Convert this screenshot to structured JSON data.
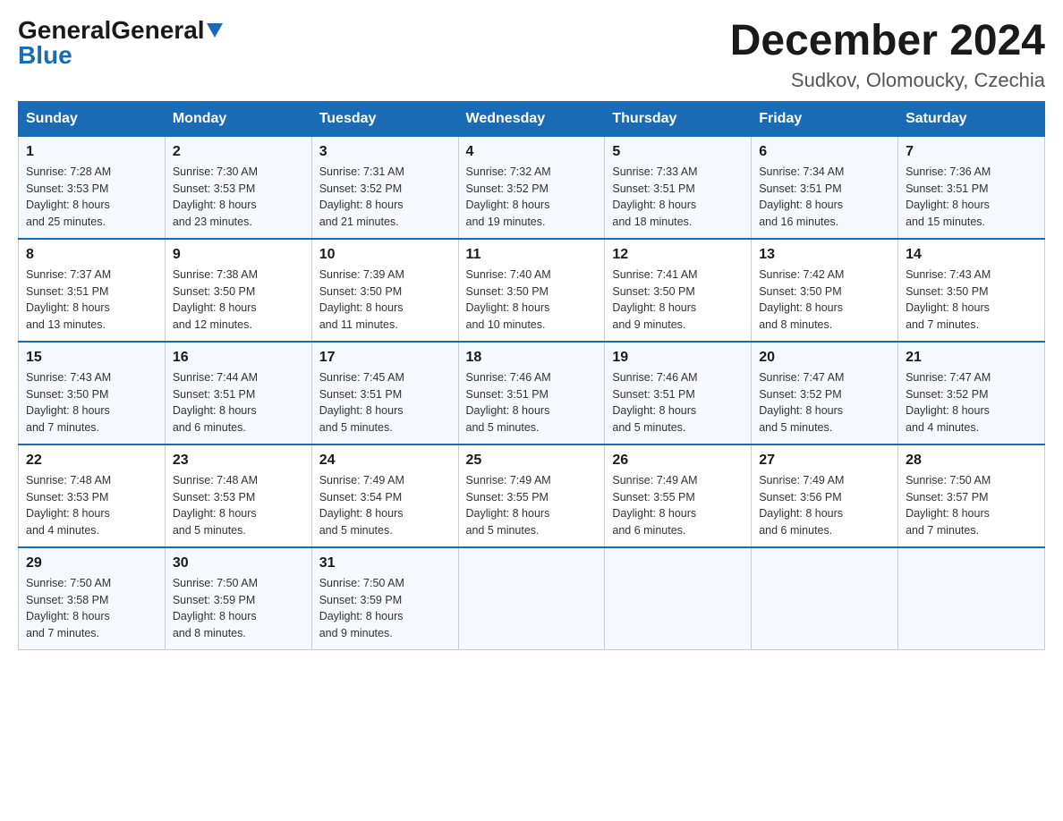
{
  "header": {
    "logo_general": "General",
    "logo_blue": "Blue",
    "month_year": "December 2024",
    "location": "Sudkov, Olomoucky, Czechia"
  },
  "days_of_week": [
    "Sunday",
    "Monday",
    "Tuesday",
    "Wednesday",
    "Thursday",
    "Friday",
    "Saturday"
  ],
  "weeks": [
    [
      {
        "day": "1",
        "sunrise": "7:28 AM",
        "sunset": "3:53 PM",
        "daylight": "8 hours and 25 minutes."
      },
      {
        "day": "2",
        "sunrise": "7:30 AM",
        "sunset": "3:53 PM",
        "daylight": "8 hours and 23 minutes."
      },
      {
        "day": "3",
        "sunrise": "7:31 AM",
        "sunset": "3:52 PM",
        "daylight": "8 hours and 21 minutes."
      },
      {
        "day": "4",
        "sunrise": "7:32 AM",
        "sunset": "3:52 PM",
        "daylight": "8 hours and 19 minutes."
      },
      {
        "day": "5",
        "sunrise": "7:33 AM",
        "sunset": "3:51 PM",
        "daylight": "8 hours and 18 minutes."
      },
      {
        "day": "6",
        "sunrise": "7:34 AM",
        "sunset": "3:51 PM",
        "daylight": "8 hours and 16 minutes."
      },
      {
        "day": "7",
        "sunrise": "7:36 AM",
        "sunset": "3:51 PM",
        "daylight": "8 hours and 15 minutes."
      }
    ],
    [
      {
        "day": "8",
        "sunrise": "7:37 AM",
        "sunset": "3:51 PM",
        "daylight": "8 hours and 13 minutes."
      },
      {
        "day": "9",
        "sunrise": "7:38 AM",
        "sunset": "3:50 PM",
        "daylight": "8 hours and 12 minutes."
      },
      {
        "day": "10",
        "sunrise": "7:39 AM",
        "sunset": "3:50 PM",
        "daylight": "8 hours and 11 minutes."
      },
      {
        "day": "11",
        "sunrise": "7:40 AM",
        "sunset": "3:50 PM",
        "daylight": "8 hours and 10 minutes."
      },
      {
        "day": "12",
        "sunrise": "7:41 AM",
        "sunset": "3:50 PM",
        "daylight": "8 hours and 9 minutes."
      },
      {
        "day": "13",
        "sunrise": "7:42 AM",
        "sunset": "3:50 PM",
        "daylight": "8 hours and 8 minutes."
      },
      {
        "day": "14",
        "sunrise": "7:43 AM",
        "sunset": "3:50 PM",
        "daylight": "8 hours and 7 minutes."
      }
    ],
    [
      {
        "day": "15",
        "sunrise": "7:43 AM",
        "sunset": "3:50 PM",
        "daylight": "8 hours and 7 minutes."
      },
      {
        "day": "16",
        "sunrise": "7:44 AM",
        "sunset": "3:51 PM",
        "daylight": "8 hours and 6 minutes."
      },
      {
        "day": "17",
        "sunrise": "7:45 AM",
        "sunset": "3:51 PM",
        "daylight": "8 hours and 5 minutes."
      },
      {
        "day": "18",
        "sunrise": "7:46 AM",
        "sunset": "3:51 PM",
        "daylight": "8 hours and 5 minutes."
      },
      {
        "day": "19",
        "sunrise": "7:46 AM",
        "sunset": "3:51 PM",
        "daylight": "8 hours and 5 minutes."
      },
      {
        "day": "20",
        "sunrise": "7:47 AM",
        "sunset": "3:52 PM",
        "daylight": "8 hours and 5 minutes."
      },
      {
        "day": "21",
        "sunrise": "7:47 AM",
        "sunset": "3:52 PM",
        "daylight": "8 hours and 4 minutes."
      }
    ],
    [
      {
        "day": "22",
        "sunrise": "7:48 AM",
        "sunset": "3:53 PM",
        "daylight": "8 hours and 4 minutes."
      },
      {
        "day": "23",
        "sunrise": "7:48 AM",
        "sunset": "3:53 PM",
        "daylight": "8 hours and 5 minutes."
      },
      {
        "day": "24",
        "sunrise": "7:49 AM",
        "sunset": "3:54 PM",
        "daylight": "8 hours and 5 minutes."
      },
      {
        "day": "25",
        "sunrise": "7:49 AM",
        "sunset": "3:55 PM",
        "daylight": "8 hours and 5 minutes."
      },
      {
        "day": "26",
        "sunrise": "7:49 AM",
        "sunset": "3:55 PM",
        "daylight": "8 hours and 6 minutes."
      },
      {
        "day": "27",
        "sunrise": "7:49 AM",
        "sunset": "3:56 PM",
        "daylight": "8 hours and 6 minutes."
      },
      {
        "day": "28",
        "sunrise": "7:50 AM",
        "sunset": "3:57 PM",
        "daylight": "8 hours and 7 minutes."
      }
    ],
    [
      {
        "day": "29",
        "sunrise": "7:50 AM",
        "sunset": "3:58 PM",
        "daylight": "8 hours and 7 minutes."
      },
      {
        "day": "30",
        "sunrise": "7:50 AM",
        "sunset": "3:59 PM",
        "daylight": "8 hours and 8 minutes."
      },
      {
        "day": "31",
        "sunrise": "7:50 AM",
        "sunset": "3:59 PM",
        "daylight": "8 hours and 9 minutes."
      },
      null,
      null,
      null,
      null
    ]
  ],
  "labels": {
    "sunrise": "Sunrise:",
    "sunset": "Sunset:",
    "daylight": "Daylight:"
  }
}
